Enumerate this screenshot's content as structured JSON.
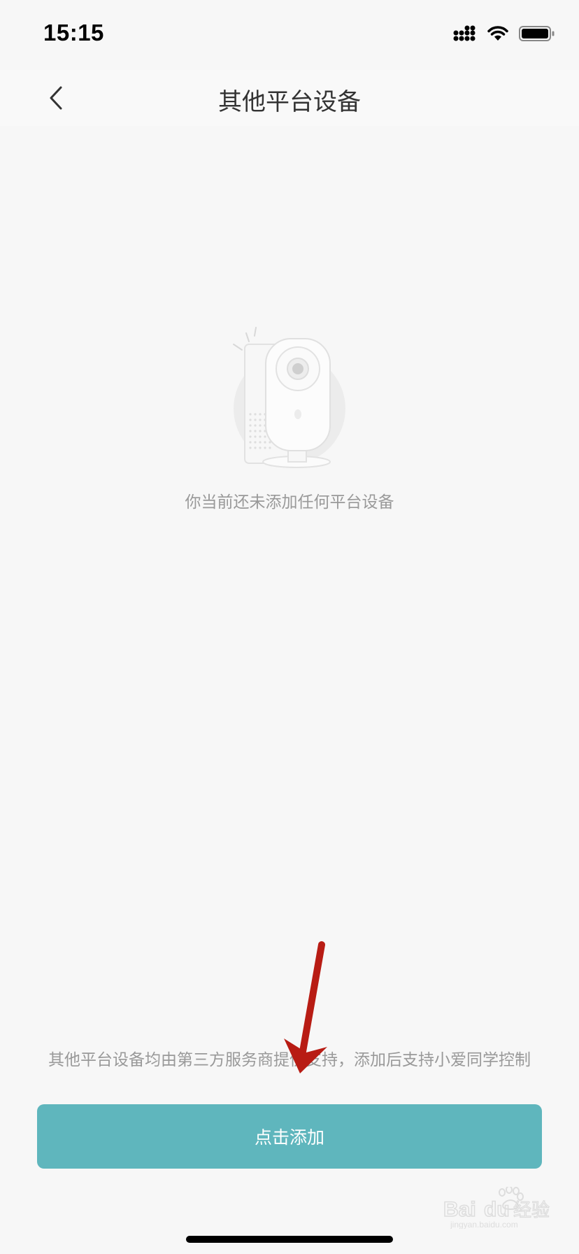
{
  "status_bar": {
    "time": "15:15",
    "icons": [
      "signal-icon",
      "wifi-icon",
      "battery-icon"
    ]
  },
  "nav": {
    "back_icon": "chevron-left-icon",
    "title": "其他平台设备"
  },
  "empty_state": {
    "illustration": "camera-illustration",
    "message": "你当前还未添加任何平台设备"
  },
  "footer": {
    "note": "其他平台设备均由第三方服务商提供支持，添加后支持小爱同学控制",
    "button_label": "点击添加"
  },
  "colors": {
    "background": "#f7f7f7",
    "accent": "#5fb6bd",
    "annotation": "#b81c14"
  },
  "watermark": {
    "brand": "Baidu经验",
    "url": "jingyan.baidu.com"
  }
}
